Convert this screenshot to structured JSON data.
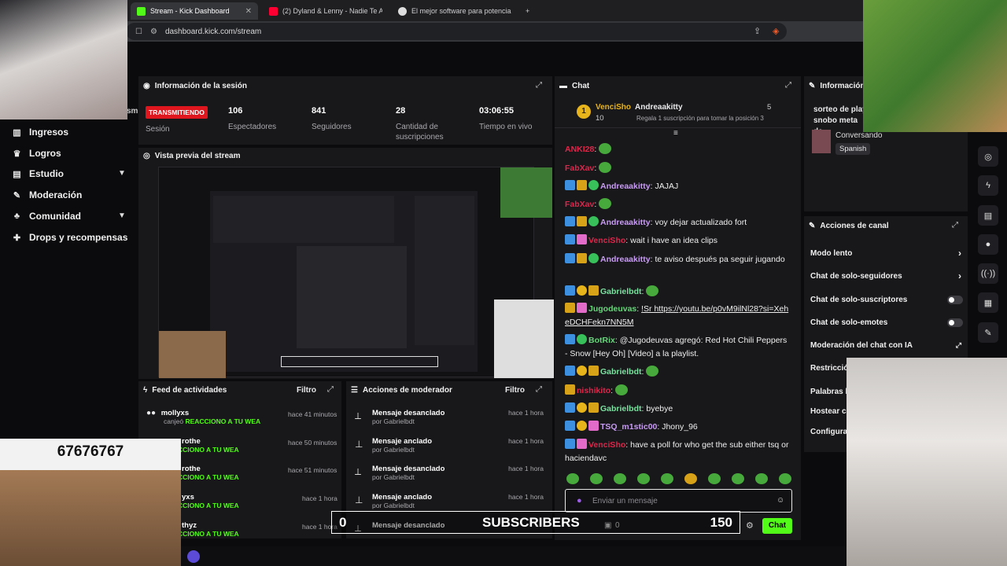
{
  "browser": {
    "tabs": [
      {
        "title": "Stream - Kick Dashboard",
        "active": true
      },
      {
        "title": "(2) Dyland & Lenny - Nadie Te Amará"
      },
      {
        "title": "El mejor software para potenciar"
      }
    ],
    "url": "dashboard.kick.com/stream"
  },
  "sidebar": {
    "items": [
      {
        "label": "Ingresos",
        "icon": "bar-chart-icon"
      },
      {
        "label": "Logros",
        "icon": "trophy-icon"
      },
      {
        "label": "Estudio",
        "icon": "studio-icon",
        "expand": true
      },
      {
        "label": "Moderación",
        "icon": "wrench-icon"
      },
      {
        "label": "Comunidad",
        "icon": "people-icon",
        "expand": true
      },
      {
        "label": "Drops y recompensas",
        "icon": "gift-icon"
      }
    ],
    "fragment": "sm"
  },
  "session": {
    "title": "Información de la sesión",
    "live_badge": "TRANSMITIENDO",
    "session_label": "Sesión",
    "viewers": "106",
    "viewers_label": "Espectadores",
    "followers": "841",
    "followers_label": "Seguidores",
    "subs": "28",
    "subs_label": "Cantidad de suscripciones",
    "uptime": "03:06:55",
    "uptime_label": "Tiempo en vivo"
  },
  "preview": {
    "title": "Vista previa del stream"
  },
  "activity": {
    "title": "Feed de actividades",
    "filter": "Filtro",
    "items": [
      {
        "user": "mollyxs",
        "action": "canjeó",
        "reward": "REACCIONO A TU WEA",
        "time": "hace 41 minutos"
      },
      {
        "user": "rothe",
        "action": "",
        "reward": "REACCIONO A TU WEA",
        "time": "hace 50 minutos"
      },
      {
        "user": "rothe",
        "action": "",
        "reward": "REACCIONO A TU WEA",
        "time": "hace 51 minutos"
      },
      {
        "user": "yxs",
        "action": "",
        "reward": "REACCIONO A TU WEA",
        "time": "hace 1 hora"
      },
      {
        "user": "thyz",
        "action": "",
        "reward": "REACCIONO A TU WEA",
        "time": "hace 1 hora"
      }
    ]
  },
  "modactions": {
    "title": "Acciones de moderador",
    "filter": "Filtro",
    "items": [
      {
        "action": "Mensaje desanclado",
        "by": "por Gabrielbdt",
        "time": "hace 1 hora",
        "icon": "unpin-icon"
      },
      {
        "action": "Mensaje anclado",
        "by": "por Gabrielbdt",
        "time": "hace 1 hora",
        "icon": "pin-icon"
      },
      {
        "action": "Mensaje desanclado",
        "by": "por Gabrielbdt",
        "time": "hace 1 hora",
        "icon": "unpin-icon"
      },
      {
        "action": "Mensaje anclado",
        "by": "por Gabrielbdt",
        "time": "hace 1 hora",
        "icon": "pin-icon"
      },
      {
        "action": "Mensaje desanclado",
        "by": "",
        "time": "",
        "icon": "unpin-icon"
      }
    ]
  },
  "chat": {
    "title": "Chat",
    "top_gifter": {
      "user": "VenciSho",
      "count": "10",
      "target": "Andreaakitty",
      "target_count": "5",
      "note": "Regala 1 suscripción para tomar la posición 3"
    },
    "messages": [
      {
        "user": "ANKI28",
        "color": "#e0254a",
        "text": "",
        "badges": [],
        "emote": true
      },
      {
        "user": "FabXav",
        "color": "#e0254a",
        "text": "",
        "badges": [],
        "emote": true
      },
      {
        "user": "Andreaakitty",
        "color": "#c79bf2",
        "text": "JAJAJ",
        "badges": [
          "b-blue",
          "b-crown",
          "b-green"
        ]
      },
      {
        "user": "FabXav",
        "color": "#e0254a",
        "text": "",
        "badges": [],
        "emote": true
      },
      {
        "user": "Andreaakitty",
        "color": "#c79bf2",
        "text": "voy dejar actualizado fort",
        "badges": [
          "b-blue",
          "b-crown",
          "b-green"
        ]
      },
      {
        "user": "VenciSho",
        "color": "#e0254a",
        "text": "wait i have an idea clips",
        "badges": [
          "b-blue",
          "b-pink"
        ]
      },
      {
        "user": "Andreaakitty",
        "color": "#c79bf2",
        "text": "te aviso después pa seguir jugando",
        "badges": [
          "b-blue",
          "b-crown",
          "b-green"
        ]
      },
      {
        "user": "Gabrielbdt",
        "color": "#7ce0a0",
        "text": "",
        "badges": [
          "b-blue",
          "b-gold",
          "b-crown"
        ],
        "emote": true
      },
      {
        "user": "Jugodeuvas",
        "color": "#66d67a",
        "text": "!Sr https://youtu.be/p0vM9ilNl28?si=XeheDCHFekn7NN5M",
        "badges": [
          "b-crown",
          "b-pink"
        ]
      },
      {
        "user": "BotRix",
        "color": "#66d67a",
        "text": "@Jugodeuvas agregó: Red Hot Chili Peppers - Snow [Hey Oh] [Video] a la playlist.",
        "badges": [
          "b-blue",
          "b-green"
        ]
      },
      {
        "user": "Gabrielbdt",
        "color": "#7ce0a0",
        "text": "",
        "badges": [
          "b-blue",
          "b-gold",
          "b-crown"
        ],
        "emote": true
      },
      {
        "user": "nishikito",
        "color": "#e0254a",
        "text": "",
        "badges": [
          "b-crown"
        ],
        "emote": true
      },
      {
        "user": "Gabrielbdt",
        "color": "#7ce0a0",
        "text": "byebye",
        "badges": [
          "b-blue",
          "b-gold",
          "b-crown"
        ]
      },
      {
        "user": "TSQ_m1stic00",
        "color": "#c79bf2",
        "text": "Jhony_96",
        "badges": [
          "b-blue",
          "b-gold",
          "b-pink"
        ]
      },
      {
        "user": "VenciSho",
        "color": "#e0254a",
        "text": "have a poll for who get the sub either tsq or haciendavc",
        "badges": [
          "b-blue",
          "b-pink"
        ]
      }
    ],
    "input_placeholder": "Enviar un mensaje",
    "send_label": "Chat",
    "counter_left": "0",
    "counter_right": "0"
  },
  "info_right": {
    "title": "Información",
    "text": "sorteo de play snobo meta de",
    "status": "Conversando",
    "language": "Spanish"
  },
  "channel_actions": {
    "title": "Acciones de canal",
    "items": [
      {
        "label": "Modo lento",
        "control": "chevron"
      },
      {
        "label": "Chat de solo-seguidores",
        "control": "chevron"
      },
      {
        "label": "Chat de solo-suscriptores",
        "control": "toggle"
      },
      {
        "label": "Chat de solo-emotes",
        "control": "toggle"
      },
      {
        "label": "Moderación del chat con IA",
        "control": "external"
      },
      {
        "label": "Restricció",
        "control": ""
      },
      {
        "label": "Palabras b",
        "control": ""
      },
      {
        "label": "Hostear ca",
        "control": ""
      },
      {
        "label": "Configura",
        "control": ""
      }
    ]
  },
  "overlays": {
    "number": "67676767",
    "subs_bar": {
      "left": "0",
      "label": "SUBSCRIBERS",
      "right": "150"
    }
  },
  "colors": {
    "accent": "#53fc18",
    "live": "#e0161e",
    "panel": "#18181b"
  }
}
